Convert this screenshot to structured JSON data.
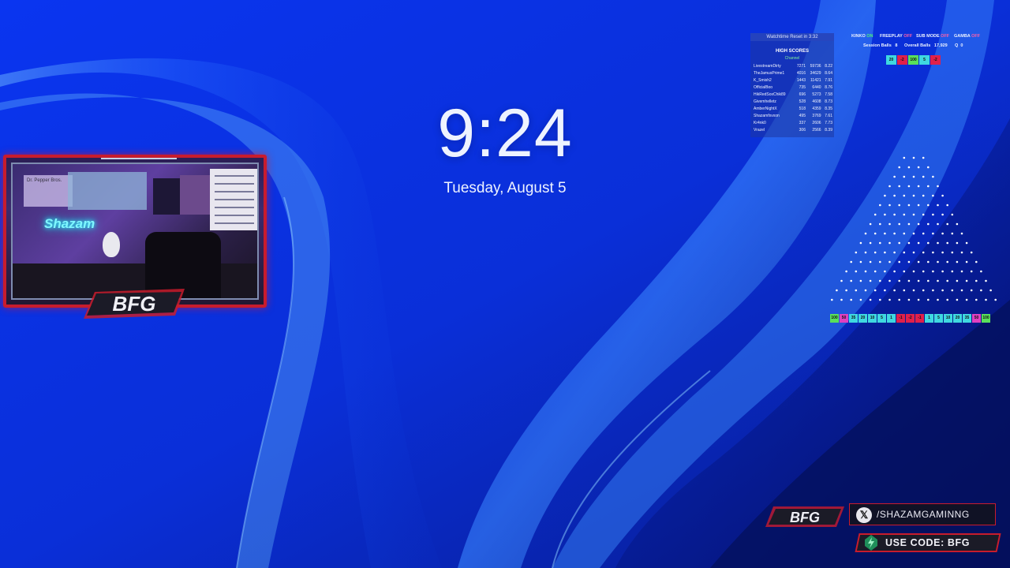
{
  "clock": {
    "time": "9:24",
    "date": "Tuesday, August 5"
  },
  "overlay": {
    "watchtime_reset": "Watchtime Reset in 3:32",
    "high_scores": {
      "title": "HIGH SCORES",
      "subtitle": "Channel",
      "rows": [
        {
          "name": "LivestreamDirty",
          "a": "7271",
          "b": "59736",
          "c": "8.22"
        },
        {
          "name": "TheJamusPrime1",
          "a": "4016",
          "b": "34629",
          "c": "8.64"
        },
        {
          "name": "K_Smish2",
          "a": "1443",
          "b": "11421",
          "c": "7.91"
        },
        {
          "name": "OfficialBoo",
          "a": "735",
          "b": "6440",
          "c": "8.76"
        },
        {
          "name": "HikRedSoxChik89",
          "a": "696",
          "b": "5273",
          "c": "7.58"
        },
        {
          "name": "Givemhelletz",
          "a": "528",
          "b": "4608",
          "c": "8.73"
        },
        {
          "name": "AmberNightX",
          "a": "518",
          "b": "4359",
          "c": "8.35"
        },
        {
          "name": "Shazamfxvxon",
          "a": "495",
          "b": "3769",
          "c": "7.61"
        },
        {
          "name": "Kr4nk0",
          "a": "337",
          "b": "2606",
          "c": "7.73"
        },
        {
          "name": "Vrazel",
          "a": "306",
          "b": "2566",
          "c": "8.39"
        }
      ]
    },
    "status": {
      "kinko_label": "KINKO",
      "kinko_value": "ON",
      "freeplay_label": "FREEPLAY",
      "freeplay_value": "OFF",
      "submode_label": "SUB MODE",
      "submode_value": "OFF",
      "gamba_label": "GAMBA",
      "gamba_value": "OFF",
      "session_label": "Session Balls",
      "session_value": "8",
      "overall_label": "Overall Balls",
      "overall_value": "17,929",
      "q_label": "Q",
      "q_value": "0"
    },
    "top_chips": [
      {
        "label": "20",
        "color": "#3fd8e0"
      },
      {
        "label": "-2",
        "color": "#e0204a"
      },
      {
        "label": "100",
        "color": "#59e05a"
      },
      {
        "label": "5",
        "color": "#3fd8e0"
      },
      {
        "label": "-2",
        "color": "#e0204a"
      }
    ],
    "plinko_slots": [
      {
        "label": "100",
        "color": "#59e05a"
      },
      {
        "label": "50",
        "color": "#e040c0"
      },
      {
        "label": "35",
        "color": "#3fd8e0"
      },
      {
        "label": "20",
        "color": "#3fd8e0"
      },
      {
        "label": "10",
        "color": "#3fd8e0"
      },
      {
        "label": "5",
        "color": "#3fd8e0"
      },
      {
        "label": "1",
        "color": "#3fd8e0"
      },
      {
        "label": "-1",
        "color": "#e0204a"
      },
      {
        "label": "-2",
        "color": "#e0204a"
      },
      {
        "label": "-1",
        "color": "#e0204a"
      },
      {
        "label": "1",
        "color": "#3fd8e0"
      },
      {
        "label": "5",
        "color": "#3fd8e0"
      },
      {
        "label": "10",
        "color": "#3fd8e0"
      },
      {
        "label": "20",
        "color": "#3fd8e0"
      },
      {
        "label": "35",
        "color": "#3fd8e0"
      },
      {
        "label": "50",
        "color": "#e040c0"
      },
      {
        "label": "100",
        "color": "#59e05a"
      }
    ]
  },
  "webcam": {
    "banner_text": "Dr. Pepper Bros.",
    "neon_sign": "Shazam",
    "logo": "BFG",
    "board_lines": [
      "MON.",
      "TUES.",
      "WED.",
      "THURS.",
      "FRI.",
      "SAT.",
      "SUN."
    ]
  },
  "branding": {
    "logo": "BFG",
    "social_icon": "x-icon",
    "handle": "/SHAZAMGAMINNG",
    "code": "USE CODE: BFG",
    "accent": "#c81c2d"
  }
}
